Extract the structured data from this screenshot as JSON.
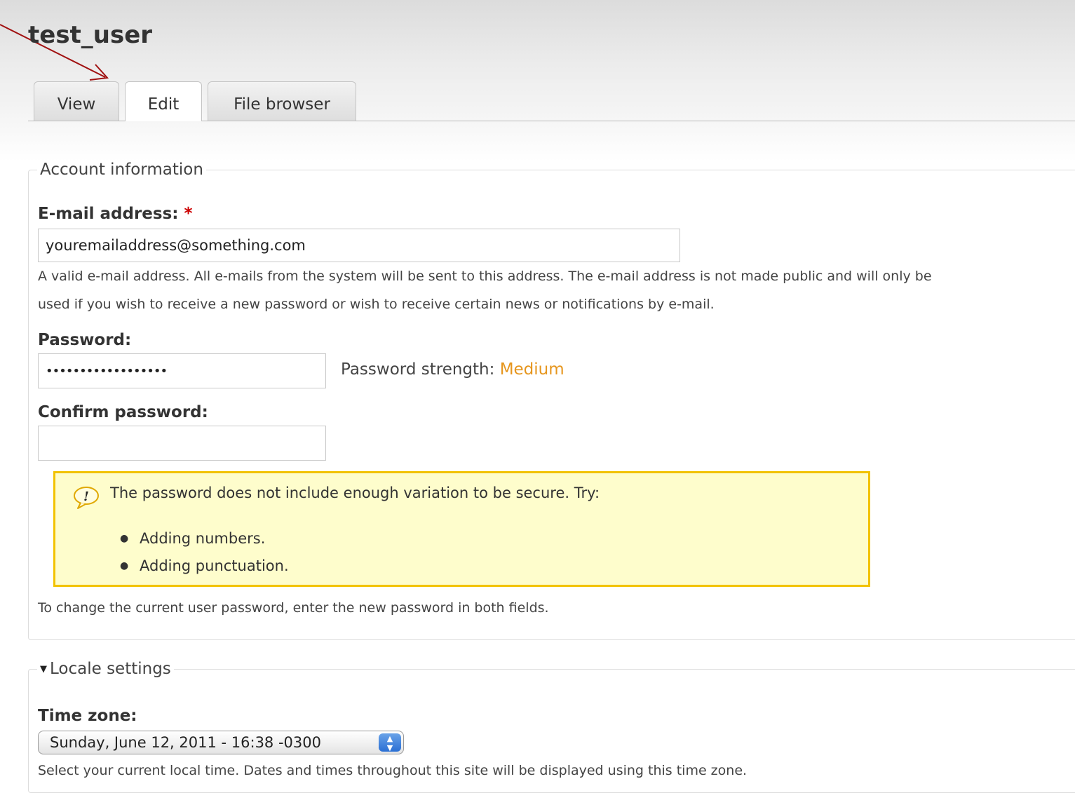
{
  "page": {
    "title": "test_user"
  },
  "tabs": [
    {
      "label": "View",
      "active": false
    },
    {
      "label": "Edit",
      "active": true
    },
    {
      "label": "File browser",
      "active": false
    }
  ],
  "account": {
    "legend": "Account information",
    "email": {
      "label": "E-mail address:",
      "required_marker": "*",
      "value": "youremailaddress@something.com",
      "description_line1": "A valid e-mail address. All e-mails from the system will be sent to this address. The e-mail address is not made public and will only be",
      "description_line2": "used if you wish to receive a new password or wish to receive certain news or notifications by e-mail."
    },
    "password": {
      "label": "Password:",
      "value": "••••••••••••••••••",
      "strength_label": "Password strength:",
      "strength_value": "Medium",
      "strength_color": "#e6961e"
    },
    "confirm_password": {
      "label": "Confirm password:",
      "value": ""
    },
    "warning": {
      "icon": "exclamation-bubble-icon",
      "message": "The password does not include enough variation to be secure. Try:",
      "suggestions": [
        "Adding numbers.",
        "Adding punctuation."
      ],
      "border_color": "#f2c200",
      "background_color": "#fefdcc"
    },
    "help_text": "To change the current user password, enter the new password in both fields."
  },
  "locale": {
    "legend": "Locale settings",
    "collapsed": false,
    "link_color": "#2a5db0",
    "timezone": {
      "label": "Time zone:",
      "selected": "Sunday, June 12, 2011 - 16:38 -0300",
      "description": "Select your current local time. Dates and times throughout this site will be displayed using this time zone."
    }
  },
  "annotation": {
    "color": "#a01010"
  }
}
